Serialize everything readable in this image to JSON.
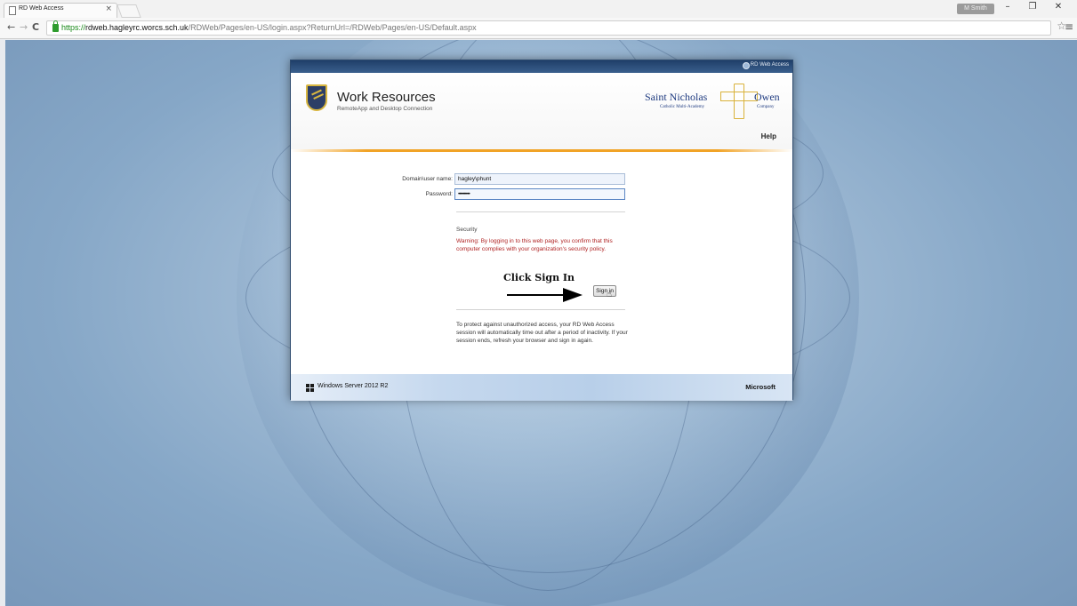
{
  "browser": {
    "tab_title": "RD Web Access",
    "tab_close": "×",
    "user_badge": "M Smith",
    "window_minimize": "–",
    "window_restore": "❐",
    "window_close": "✕",
    "back": "←",
    "forward": "→",
    "reload": "C",
    "url_https": "https://",
    "url_host": "rdweb.hagleyrc.worcs.sch.uk",
    "url_path": "/RDWeb/Pages/en-US/login.aspx?ReturnUrl=/RDWeb/Pages/en-US/Default.aspx",
    "bookmark_star": "☆",
    "menu": "≡"
  },
  "panel": {
    "top_label": "RD Web Access",
    "title": "Work Resources",
    "subtitle": "RemoteApp and Desktop Connection",
    "logo": {
      "left": "Saint Nicholas",
      "right": "Owen",
      "sub_left": "Catholic Multi-Academy",
      "sub_right": "Company"
    },
    "help": "Help"
  },
  "form": {
    "username_label": "Domain\\user name:",
    "username_value": "hagley\\phunt",
    "password_label": "Password:",
    "password_value": "••••••••••",
    "security_title": "Security",
    "security_warning": "Warning: By logging in to this web page, you confirm that this computer complies with your organization's security policy.",
    "annotation": "Click Sign In",
    "signin_label": "Sign in",
    "info": "To protect against unauthorized access, your RD Web Access session will automatically time out after a period of inactivity. If your session ends, refresh your browser and sign in again."
  },
  "footer": {
    "left": "Windows Server 2012 R2",
    "right": "Microsoft"
  },
  "colors": {
    "accent_orange": "#f1a326",
    "panel_topbar": "#1f3f69",
    "warning_red": "#b02424",
    "background_blue": "#86a7c7"
  }
}
